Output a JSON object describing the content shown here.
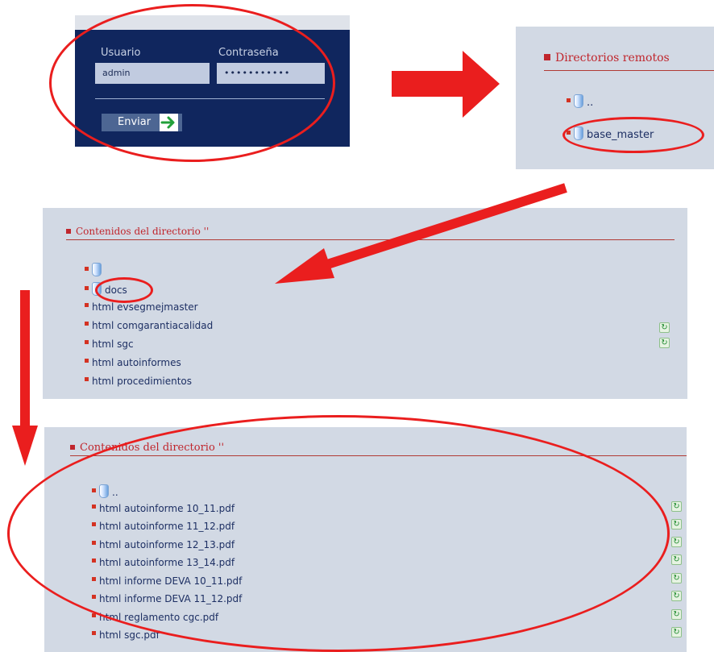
{
  "login": {
    "user_label": "Usuario",
    "user_value": "admin",
    "password_label": "Contraseña",
    "password_value": "•••••••••••",
    "send_label": "Enviar"
  },
  "remote_panel": {
    "title": "Directorios remotos",
    "items": [
      "..",
      "base_master"
    ]
  },
  "dir_panel_1": {
    "title": "Contenidos del directorio ''",
    "items": [
      "",
      "docs",
      "html evsegmejmaster",
      "html comgarantiacalidad",
      "html sgc",
      "html autoinformes",
      "html procedimientos"
    ]
  },
  "dir_panel_2": {
    "title": "Contenidos del directorio ''",
    "items": [
      "..",
      "html autoinforme 10_11.pdf",
      "html autoinforme 11_12.pdf",
      "html autoinforme 12_13.pdf",
      "html autoinforme 13_14.pdf",
      "html informe DEVA 10_11.pdf",
      "html informe DEVA 11_12.pdf",
      "html reglamento cgc.pdf",
      "html sgc.pdf"
    ]
  },
  "colors": {
    "annotation": "#ea1e1e",
    "login_bg": "#10265e",
    "panel_bg": "#d2d9e4",
    "title_red": "#c0262d"
  },
  "icons": [
    "folder-icon",
    "refresh-icon",
    "arrow-right-icon",
    "bullet-icon"
  ]
}
